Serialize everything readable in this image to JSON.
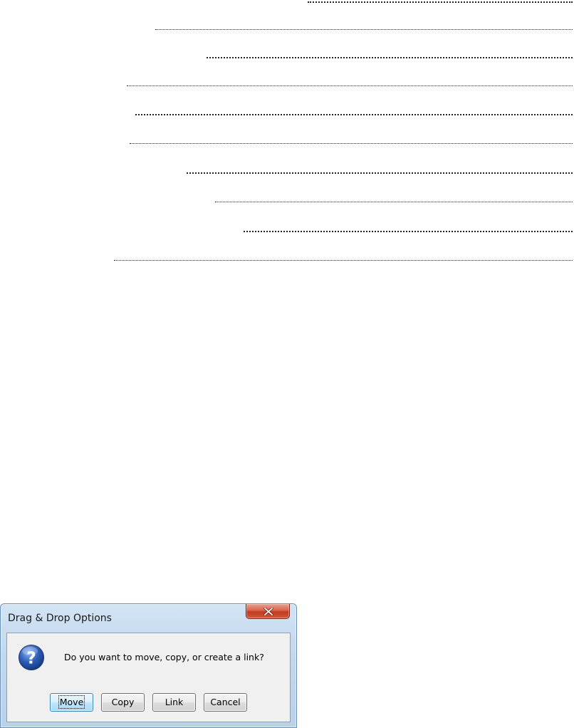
{
  "dialog": {
    "title": "Drag & Drop Options",
    "close_icon": "close-x-icon",
    "question_icon": "question-mark-icon",
    "message": "Do you want to move, copy, or create a link?",
    "buttons": {
      "move": "Move",
      "copy": "Copy",
      "link": "Link",
      "cancel": "Cancel"
    },
    "default_button": "move"
  },
  "colors": {
    "titlebar": "#c3d8ee",
    "close_button": "#c23a22",
    "content_background": "#f0f0f0",
    "question_icon": "#2d5fb8"
  }
}
